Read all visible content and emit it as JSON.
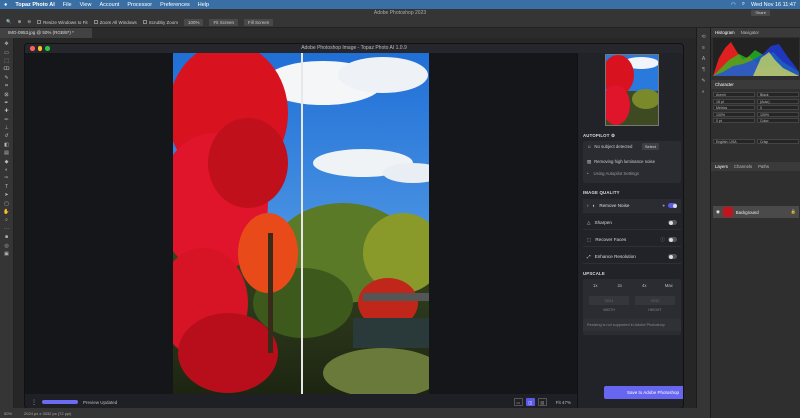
{
  "mac_menu": {
    "apple": "",
    "app": "Topaz Photo AI",
    "items": [
      "File",
      "View",
      "Account",
      "Processor",
      "Preferences",
      "Help"
    ],
    "datetime": "Wed Nov 16  11:47"
  },
  "ps": {
    "window_title": "Adobe Photoshop 2023",
    "share_label": "Share",
    "options": {
      "resize_windows": "Resize Windows to Fit",
      "zoom_all": "Zoom All Windows",
      "scrubby_zoom": "Scrubby Zoom",
      "pct100": "100%",
      "fit_screen": "Fit Screen",
      "fill_screen": "Fill Screen"
    },
    "doc_tab": "IMG-0953.jpg @ 50% (RGB/8*) *",
    "status_zoom": "50%",
    "status_info": "2024 px x 3032 px (72 ppi)",
    "panels": {
      "histogram_tab": "Histogram",
      "navigator_tab": "Navigator",
      "character_tab": "Character",
      "font_family": "Avenir",
      "font_style": "Black",
      "font_size": "18 pt",
      "leading": "(Auto)",
      "kerning": "Metrics",
      "tracking": "0",
      "scale_v": "100%",
      "scale_h": "100%",
      "baseline": "0 pt",
      "color_label": "Color:",
      "language": "English: USA",
      "aa": "Crisp",
      "layers_tab": "Layers",
      "channels_tab": "Channels",
      "paths_tab": "Paths",
      "layer_name": "Background"
    }
  },
  "topaz": {
    "title": "Adobe Photoshop Image - Topaz Photo AI 1.0.9",
    "preview_status": "Preview Updated",
    "zoom_level": "Fit  47%",
    "autopilot": {
      "heading": "AUTOPILOT",
      "no_subject": "No subject detected",
      "select_label": "Select",
      "removing": "Removing high luminance noise",
      "using_settings": "Using Autopilot Settings"
    },
    "quality_heading": "IMAGE QUALITY",
    "enhancements": [
      {
        "label": "Remove Noise",
        "on": true
      },
      {
        "label": "Sharpen",
        "on": false
      },
      {
        "label": "Recover Faces",
        "on": false
      },
      {
        "label": "Enhance Resolution",
        "on": false
      }
    ],
    "upscale": {
      "heading": "UPSCALE",
      "options": [
        "1x",
        "2x",
        "4x",
        "Max"
      ],
      "width_value": "3024",
      "height_value": "4032",
      "width_label": "WIDTH",
      "height_label": "HEIGHT",
      "note": "Resizing is not supported in Adobe Photoshop"
    },
    "save_label": "Save to Adobe Photoshop"
  },
  "colors": {
    "accent": "#6766f0",
    "panel_bg": "#222328"
  }
}
